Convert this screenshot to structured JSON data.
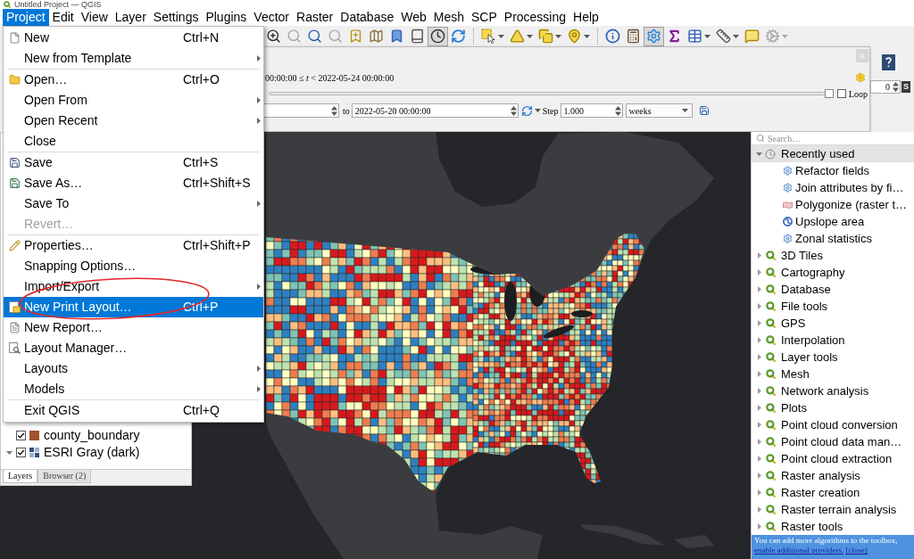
{
  "window": {
    "title": "Untitled Project — QGIS"
  },
  "menu_bar": [
    {
      "label": "Project",
      "selected": true
    },
    {
      "label": "Edit",
      "selected": false
    },
    {
      "label": "View",
      "selected": false
    },
    {
      "label": "Layer",
      "selected": false
    },
    {
      "label": "Settings",
      "selected": false
    },
    {
      "label": "Plugins",
      "selected": false
    },
    {
      "label": "Vector",
      "selected": false
    },
    {
      "label": "Raster",
      "selected": false
    },
    {
      "label": "Database",
      "selected": false
    },
    {
      "label": "Web",
      "selected": false
    },
    {
      "label": "Mesh",
      "selected": false
    },
    {
      "label": "SCP",
      "selected": false
    },
    {
      "label": "Processing",
      "selected": false
    },
    {
      "label": "Help",
      "selected": false
    }
  ],
  "toolbar": [
    [
      {
        "pressed": false,
        "disabled": false,
        "dropdown": false
      },
      {
        "pressed": false,
        "disabled": true,
        "dropdown": false
      },
      {
        "pressed": false,
        "disabled": false,
        "dropdown": false
      },
      {
        "pressed": false,
        "disabled": true,
        "dropdown": false
      },
      {
        "pressed": false,
        "disabled": false,
        "dropdown": false
      },
      {
        "pressed": false,
        "disabled": false,
        "dropdown": false
      },
      {
        "pressed": false,
        "disabled": false,
        "dropdown": false
      },
      {
        "pressed": false,
        "disabled": false,
        "dropdown": false
      },
      {
        "pressed": true,
        "disabled": false,
        "dropdown": false
      },
      {
        "pressed": false,
        "disabled": false,
        "dropdown": false
      }
    ],
    [
      {
        "pressed": false,
        "disabled": false,
        "dropdown": true
      },
      {
        "pressed": false,
        "disabled": false,
        "dropdown": true
      },
      {
        "pressed": false,
        "disabled": false,
        "dropdown": true
      },
      {
        "pressed": false,
        "disabled": false,
        "dropdown": true
      }
    ],
    [
      {
        "pressed": false,
        "disabled": false,
        "dropdown": false
      },
      {
        "pressed": false,
        "disabled": false,
        "dropdown": false
      },
      {
        "pressed": true,
        "disabled": false,
        "dropdown": false
      },
      {
        "pressed": false,
        "disabled": false,
        "dropdown": false
      },
      {
        "pressed": false,
        "disabled": false,
        "dropdown": true
      },
      {
        "pressed": false,
        "disabled": false,
        "dropdown": true
      },
      {
        "pressed": false,
        "disabled": false,
        "dropdown": false
      },
      {
        "pressed": false,
        "disabled": true,
        "dropdown": true
      }
    ]
  ],
  "project_menu": {
    "items": [
      {
        "kind": "item",
        "label": "New",
        "shortcut": "Ctrl+N",
        "submenu": false,
        "disabled": false,
        "selected": false
      },
      {
        "kind": "item",
        "label": "New from Template",
        "submenu": true,
        "disabled": false,
        "selected": false
      },
      {
        "kind": "separator"
      },
      {
        "kind": "item",
        "label": "Open…",
        "shortcut": "Ctrl+O",
        "submenu": false,
        "disabled": false,
        "selected": false
      },
      {
        "kind": "item",
        "label": "Open From",
        "submenu": true,
        "disabled": false,
        "selected": false
      },
      {
        "kind": "item",
        "label": "Open Recent",
        "submenu": true,
        "disabled": false,
        "selected": false
      },
      {
        "kind": "item",
        "label": "Close",
        "submenu": false,
        "disabled": false,
        "selected": false
      },
      {
        "kind": "separator"
      },
      {
        "kind": "item",
        "label": "Save",
        "shortcut": "Ctrl+S",
        "submenu": false,
        "disabled": false,
        "selected": false
      },
      {
        "kind": "item",
        "label": "Save As…",
        "shortcut": "Ctrl+Shift+S",
        "submenu": false,
        "disabled": false,
        "selected": false
      },
      {
        "kind": "item",
        "label": "Save To",
        "submenu": true,
        "disabled": false,
        "selected": false
      },
      {
        "kind": "item",
        "label": "Revert…",
        "submenu": false,
        "disabled": true,
        "selected": false
      },
      {
        "kind": "separator"
      },
      {
        "kind": "item",
        "label": "Properties…",
        "shortcut": "Ctrl+Shift+P",
        "submenu": false,
        "disabled": false,
        "selected": false
      },
      {
        "kind": "item",
        "label": "Snapping Options…",
        "submenu": false,
        "disabled": false,
        "selected": false
      },
      {
        "kind": "item",
        "label": "Import/Export",
        "submenu": true,
        "disabled": false,
        "selected": false
      },
      {
        "kind": "item",
        "label": "New Print Layout…",
        "shortcut": "Ctrl+P",
        "submenu": false,
        "disabled": false,
        "selected": true
      },
      {
        "kind": "item",
        "label": "New Report…",
        "submenu": false,
        "disabled": false,
        "selected": false
      },
      {
        "kind": "item",
        "label": "Layout Manager…",
        "submenu": false,
        "disabled": false,
        "selected": false
      },
      {
        "kind": "item",
        "label": "Layouts",
        "submenu": true,
        "disabled": false,
        "selected": false
      },
      {
        "kind": "item",
        "label": "Models",
        "submenu": true,
        "disabled": false,
        "selected": false
      },
      {
        "kind": "separator"
      },
      {
        "kind": "item",
        "label": "Exit QGIS",
        "shortcut": "Ctrl+Q",
        "submenu": false,
        "disabled": false,
        "selected": false
      }
    ]
  },
  "temporal_controller": {
    "range": "00:00:00 ≤ *t* < 2022-05-24 00:00:00",
    "slider": {
      "level": 1
    },
    "loop": {
      "label": "Loop",
      "checked": false
    },
    "to_label": "to",
    "end": {
      "value": "2022-05-20 00:00:00"
    },
    "step_label": "Step",
    "step": {
      "value": "1.000"
    },
    "unit": {
      "value": "weeks"
    }
  },
  "right_toolbar": {
    "spin_value": "0",
    "tool_label": "S"
  },
  "layers_panel": {
    "layers": [
      {
        "name": "county_boundary",
        "kind": "vector",
        "checked": true,
        "color": "#a0522d"
      },
      {
        "name": "ESRI Gray (dark)",
        "kind": "raster",
        "checked": true,
        "expanded": true
      }
    ],
    "tabs": [
      {
        "label": "Layers",
        "selected": true
      },
      {
        "label": "Browser (2)",
        "selected": false
      }
    ]
  },
  "processing_toolbox": {
    "search": {
      "placeholder": "Search…"
    },
    "tree": [
      {
        "label": "Recently used",
        "kind": "recent",
        "expanded": true,
        "selected": true,
        "children": [
          {
            "label": "Refactor fields",
            "kind": "native",
            "selected": false
          },
          {
            "label": "Join attributes by fi…",
            "kind": "native",
            "selected": false
          },
          {
            "label": "Polygonize (raster t…",
            "kind": "gdal",
            "selected": false
          },
          {
            "label": "Upslope area",
            "kind": "external",
            "selected": false
          },
          {
            "label": "Zonal statistics",
            "kind": "native",
            "selected": false
          }
        ]
      },
      {
        "label": "3D Tiles",
        "kind": "provider",
        "expanded": false,
        "selected": false
      },
      {
        "label": "Cartography",
        "kind": "provider",
        "expanded": false,
        "selected": false
      },
      {
        "label": "Database",
        "kind": "provider",
        "expanded": false,
        "selected": false
      },
      {
        "label": "File tools",
        "kind": "provider",
        "expanded": false,
        "selected": false
      },
      {
        "label": "GPS",
        "kind": "provider",
        "expanded": false,
        "selected": false
      },
      {
        "label": "Interpolation",
        "kind": "provider",
        "expanded": false,
        "selected": false
      },
      {
        "label": "Layer tools",
        "kind": "provider",
        "expanded": false,
        "selected": false
      },
      {
        "label": "Mesh",
        "kind": "provider",
        "expanded": false,
        "selected": false
      },
      {
        "label": "Network analysis",
        "kind": "provider",
        "expanded": false,
        "selected": false
      },
      {
        "label": "Plots",
        "kind": "provider",
        "expanded": false,
        "selected": false
      },
      {
        "label": "Point cloud conversion",
        "kind": "provider",
        "expanded": false,
        "selected": false
      },
      {
        "label": "Point cloud data man…",
        "kind": "provider",
        "expanded": false,
        "selected": false
      },
      {
        "label": "Point cloud extraction",
        "kind": "provider",
        "expanded": false,
        "selected": false
      },
      {
        "label": "Raster analysis",
        "kind": "provider",
        "expanded": false,
        "selected": false
      },
      {
        "label": "Raster creation",
        "kind": "provider",
        "expanded": false,
        "selected": false
      },
      {
        "label": "Raster terrain analysis",
        "kind": "provider",
        "expanded": false,
        "selected": false
      },
      {
        "label": "Raster tools",
        "kind": "provider",
        "expanded": false,
        "selected": false
      }
    ],
    "info_bar": {
      "text": "You can add more algorithms to the toolbox,",
      "link": "enable additional providers.",
      "close": "[close]"
    }
  }
}
